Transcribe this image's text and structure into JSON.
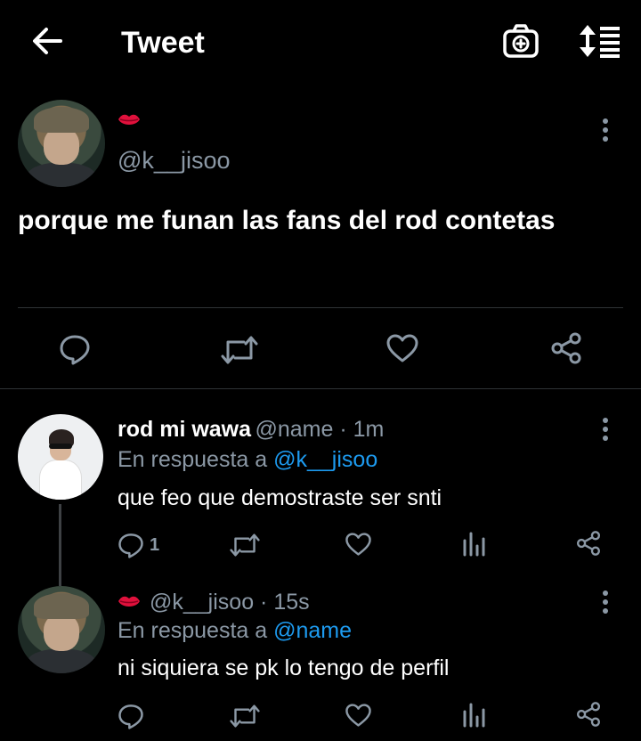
{
  "header": {
    "title": "Tweet",
    "back_icon": "arrow-left-icon",
    "camera_icon": "camera-add-icon",
    "sort_icon": "sort-icon"
  },
  "main_tweet": {
    "display_name_emoji": "lips-emoji",
    "handle": "@k__jisoo",
    "text": "porque me funan las fans del rod contetas"
  },
  "replies": [
    {
      "name": "rod mi wawa",
      "handle_time": "@name · 1m",
      "reply_prefix": "En respuesta a ",
      "reply_mention": "@k__jisoo",
      "text": "que feo que demostraste ser snti",
      "reply_count": "1"
    },
    {
      "name_emoji": "lips-emoji",
      "handle_time": "@k__jisoo · 15s",
      "reply_prefix": "En respuesta a ",
      "reply_mention": "@name",
      "text": "ni siquiera se pk lo tengo de perfil",
      "reply_count": ""
    }
  ],
  "colors": {
    "background": "#000000",
    "text": "#ffffff",
    "muted": "#8b98a5",
    "mention": "#1d9bf0",
    "divider": "#2f3336",
    "lips": "#e0113c"
  }
}
